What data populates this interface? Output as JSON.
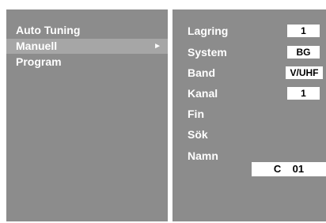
{
  "menu": {
    "items": [
      {
        "label": "Auto Tuning"
      },
      {
        "label": "Manuell",
        "arrow": "►"
      },
      {
        "label": "Program"
      }
    ]
  },
  "settings": {
    "lagring": {
      "label": "Lagring",
      "value": "1"
    },
    "system": {
      "label": "System",
      "value": "BG"
    },
    "band": {
      "label": "Band",
      "value": "V/UHF"
    },
    "kanal": {
      "label": "Kanal",
      "value": "1"
    },
    "fin": {
      "label": "Fin"
    },
    "sok": {
      "label": "Sök"
    },
    "namn": {
      "label": "Namn",
      "value": "C    01"
    }
  },
  "colors": {
    "panel": "#8c8c8c",
    "selected_row": "#a6a6a6",
    "text": "#ffffff",
    "value_box": "#ffffff"
  }
}
